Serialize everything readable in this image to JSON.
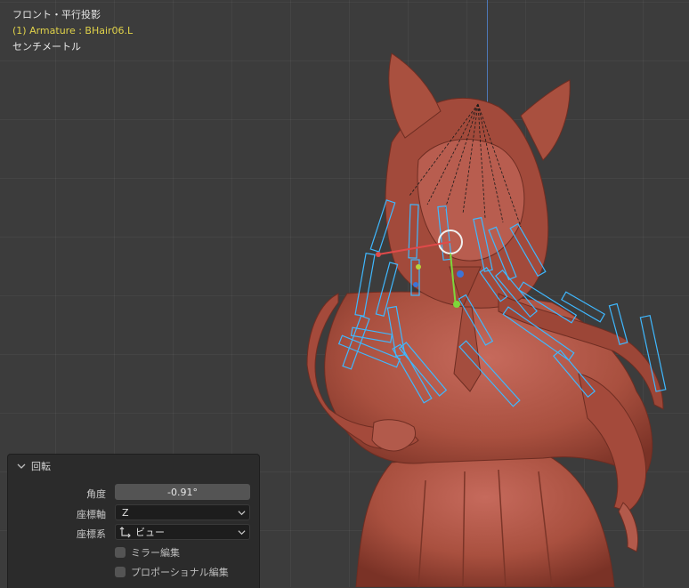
{
  "viewport": {
    "view_name": "フロント・平行投影",
    "active_object": "(1) Armature : BHair06.L",
    "unit": "センチメートル"
  },
  "operator_panel": {
    "title": "回転",
    "angle_label": "角度",
    "angle_value": "-0.91°",
    "axis_label": "座標軸",
    "axis_value": "Z",
    "orientation_label": "座標系",
    "orientation_value": "ビュー",
    "mirror_label": "ミラー編集",
    "mirror_checked": false,
    "proportional_label": "プロポーショナル編集",
    "proportional_checked": false
  },
  "colors": {
    "model": "#b5584c",
    "bone_outline": "#3fb8ff",
    "header_yellow": "#e0d24a",
    "z_axis": "#4e78b8"
  },
  "icons": [
    "chevron-down-icon",
    "orientation-gizmo-icon",
    "dropdown-arrow-icon"
  ]
}
